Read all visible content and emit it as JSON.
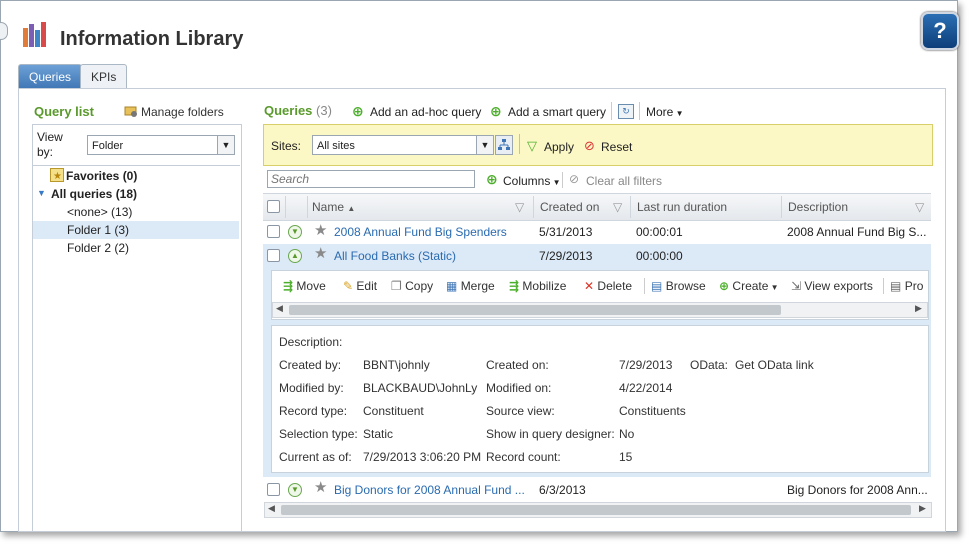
{
  "app": {
    "title": "Information Library",
    "help_label": "?"
  },
  "tabs": [
    {
      "label": "Queries"
    },
    {
      "label": "KPIs"
    }
  ],
  "left": {
    "header": "Query list",
    "manage_label": "Manage folders",
    "view_by_label": "View by:",
    "view_by_value": "Folder",
    "tree": [
      {
        "label": "Favorites (0)"
      },
      {
        "label": "All queries (18)"
      },
      {
        "label": "<none> (13)"
      },
      {
        "label": "Folder 1 (3)"
      },
      {
        "label": "Folder 2 (2)"
      }
    ]
  },
  "main": {
    "header": "Queries",
    "count": "(3)",
    "add_adhoc": "Add an ad-hoc query",
    "add_smart": "Add a smart query",
    "more": "More",
    "sites_label": "Sites:",
    "sites_value": "All sites",
    "apply": "Apply",
    "reset": "Reset",
    "search_placeholder": "Search",
    "columns": "Columns",
    "clear_filters": "Clear all filters",
    "headers": {
      "name": "Name",
      "created": "Created on",
      "last_run": "Last run duration",
      "description": "Description"
    },
    "rows": [
      {
        "name": "2008 Annual Fund Big Spenders",
        "created": "5/31/2013",
        "duration": "00:00:01",
        "description": "2008 Annual Fund Big S..."
      },
      {
        "name": "All Food Banks (Static)",
        "created": "7/29/2013",
        "duration": "00:00:00",
        "description": ""
      },
      {
        "name": "Big Donors for 2008 Annual Fund ...",
        "created": "6/3/2013",
        "duration": "",
        "description": "Big Donors for 2008 Ann..."
      }
    ],
    "actions": {
      "move": "Move",
      "edit": "Edit",
      "copy": "Copy",
      "merge": "Merge",
      "mobilize": "Mobilize",
      "delete": "Delete",
      "browse": "Browse",
      "create": "Create",
      "view_exports": "View exports",
      "pro": "Pro"
    },
    "detail": {
      "description_label": "Description:",
      "created_by_label": "Created by:",
      "created_by": "BBNT\\johnly",
      "created_on_label": "Created on:",
      "created_on": "7/29/2013",
      "odata_label": "OData:",
      "odata_link": "Get OData link",
      "modified_by_label": "Modified by:",
      "modified_by": "BLACKBAUD\\JohnLy",
      "modified_on_label": "Modified on:",
      "modified_on": "4/22/2014",
      "record_type_label": "Record type:",
      "record_type": "Constituent",
      "source_view_label": "Source view:",
      "source_view": "Constituents",
      "selection_type_label": "Selection type:",
      "selection_type": "Static",
      "show_designer_label": "Show in query designer:",
      "show_designer": "No",
      "current_as_of_label": "Current as of:",
      "current_as_of": "7/29/2013 3:06:20 PM",
      "record_count_label": "Record count:",
      "record_count": "15"
    }
  },
  "colors": {
    "accent_green": "#5a9a2c",
    "link_blue": "#2a6bb0",
    "tab_active": "#3f76b5",
    "sites_bar": "#fbf8c6",
    "selected_row": "#dce9f7"
  }
}
